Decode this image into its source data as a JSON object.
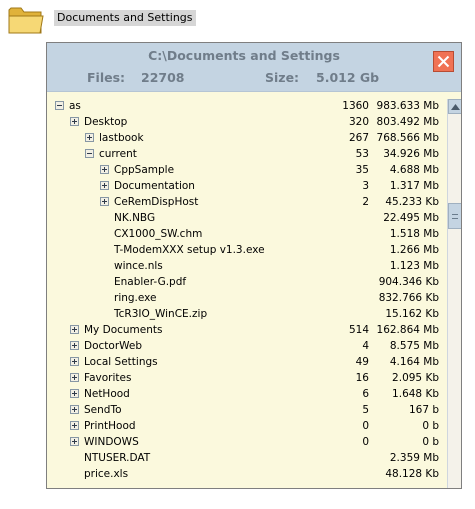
{
  "desktop": {
    "label": "Documents and Settings",
    "icon": "folder-icon"
  },
  "window": {
    "title": "C:\\Documents and Settings",
    "files_label": "Files:",
    "files_value": "22708",
    "size_label": "Size:",
    "size_value": "5.012 Gb",
    "close_icon": "close-icon",
    "accent_color": "#f07254",
    "titlebar_color": "#c4d4e2",
    "tree_background": "#fbf9dd"
  },
  "tree": {
    "rows": [
      {
        "name": "as",
        "count": "1360",
        "size": "983.633 Mb",
        "expander": "minus"
      },
      {
        "name": "Desktop",
        "count": "320",
        "size": "803.492 Mb",
        "expander": "plus"
      },
      {
        "name": "lastbook",
        "count": "267",
        "size": "768.566 Mb",
        "expander": "plus"
      },
      {
        "name": "current",
        "count": "53",
        "size": "34.926 Mb",
        "expander": "minus"
      },
      {
        "name": "CppSample",
        "count": "35",
        "size": "4.688 Mb",
        "expander": "plus"
      },
      {
        "name": "Documentation",
        "count": "3",
        "size": "1.317 Mb",
        "expander": "plus"
      },
      {
        "name": "CeRemDispHost",
        "count": "2",
        "size": "45.233 Kb",
        "expander": "plus"
      },
      {
        "name": "NK.NBG",
        "count": "",
        "size": "22.495 Mb",
        "expander": "none"
      },
      {
        "name": "CX1000_SW.chm",
        "count": "",
        "size": "1.518 Mb",
        "expander": "none"
      },
      {
        "name": "T-ModemXXX setup v1.3.exe",
        "count": "",
        "size": "1.266 Mb",
        "expander": "none"
      },
      {
        "name": "wince.nls",
        "count": "",
        "size": "1.123 Mb",
        "expander": "none"
      },
      {
        "name": "Enabler-G.pdf",
        "count": "",
        "size": "904.346 Kb",
        "expander": "none"
      },
      {
        "name": "ring.exe",
        "count": "",
        "size": "832.766 Kb",
        "expander": "none"
      },
      {
        "name": "TcR3IO_WinCE.zip",
        "count": "",
        "size": "15.162 Kb",
        "expander": "none"
      },
      {
        "name": "My Documents",
        "count": "514",
        "size": "162.864 Mb",
        "expander": "plus"
      },
      {
        "name": "DoctorWeb",
        "count": "4",
        "size": "8.575 Mb",
        "expander": "plus"
      },
      {
        "name": "Local Settings",
        "count": "49",
        "size": "4.164 Mb",
        "expander": "plus"
      },
      {
        "name": "Favorites",
        "count": "16",
        "size": "2.095 Kb",
        "expander": "plus"
      },
      {
        "name": "NetHood",
        "count": "6",
        "size": "1.648 Kb",
        "expander": "plus"
      },
      {
        "name": "SendTo",
        "count": "5",
        "size": "167 b",
        "expander": "plus"
      },
      {
        "name": "PrintHood",
        "count": "0",
        "size": "0 b",
        "expander": "plus"
      },
      {
        "name": "WINDOWS",
        "count": "0",
        "size": "0 b",
        "expander": "plus"
      },
      {
        "name": "NTUSER.DAT",
        "count": "",
        "size": "2.359 Mb",
        "expander": "none"
      },
      {
        "name": "price.xls",
        "count": "",
        "size": "48.128 Kb",
        "expander": "none"
      }
    ]
  },
  "scrollbar": {
    "up_icon": "scroll-up-arrow-icon"
  }
}
